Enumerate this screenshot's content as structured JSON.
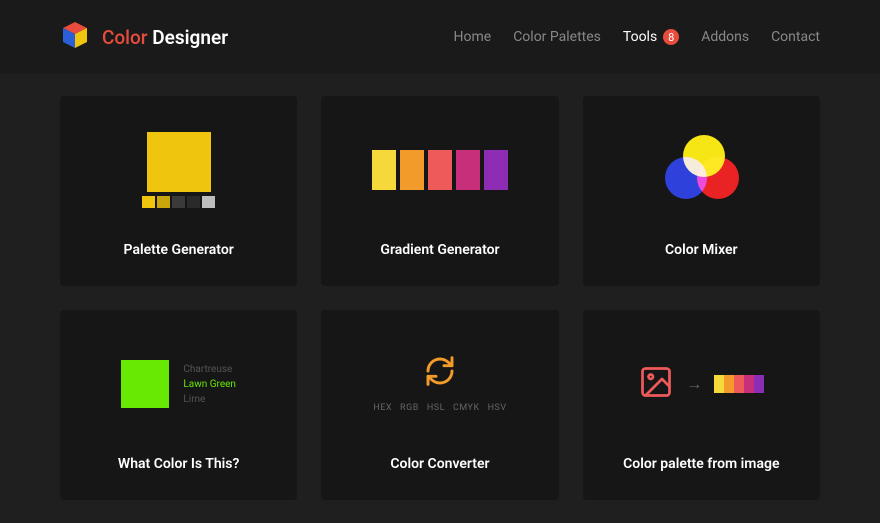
{
  "brand": {
    "word1": "Color",
    "word2": "Designer"
  },
  "nav": {
    "home": "Home",
    "palettes": "Color Palettes",
    "tools": "Tools",
    "tools_badge": "8",
    "addons": "Addons",
    "contact": "Contact"
  },
  "cards": {
    "palette_generator": {
      "title": "Palette Generator",
      "strip_colors": [
        "#efc60d",
        "#c9a50c",
        "#3a3a3a",
        "#2a2a2a",
        "#bdbdbd"
      ]
    },
    "gradient_generator": {
      "title": "Gradient Generator",
      "colors": [
        "#f5d93a",
        "#f29b2a",
        "#ee5a5a",
        "#c72f7a",
        "#8d2db3"
      ]
    },
    "color_mixer": {
      "title": "Color Mixer",
      "circles": [
        "#f5e400",
        "#1a2fd8",
        "#e70e0e"
      ]
    },
    "what_color": {
      "title": "What Color Is This?",
      "swatch": "#68e904",
      "options": [
        "Chartreuse",
        "Lawn Green",
        "Lime"
      ],
      "selected": "Lawn Green"
    },
    "color_converter": {
      "title": "Color Converter",
      "formats": [
        "HEX",
        "RGB",
        "HSL",
        "CMYK",
        "HSV"
      ]
    },
    "palette_from_image": {
      "title": "Color palette from image",
      "strip_colors": [
        "#f5d93a",
        "#f29b2a",
        "#ee5a5a",
        "#c72f7a",
        "#8d2db3"
      ]
    }
  }
}
